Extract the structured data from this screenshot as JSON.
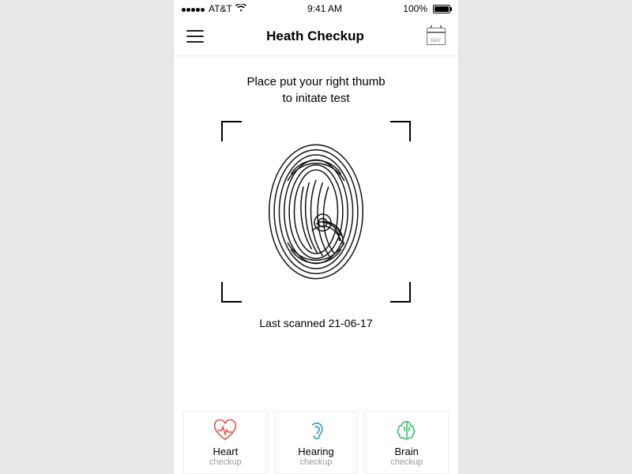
{
  "status": {
    "carrier": "AT&T",
    "time": "9:41 AM",
    "battery": "100%"
  },
  "header": {
    "title": "Heath Checkup",
    "calendar_label": "DAY"
  },
  "main": {
    "instruction": "Place put your right thumb\nto initate test",
    "last_scanned_prefix": "Last scanned ",
    "last_scanned_date": "21-06-17"
  },
  "cards": [
    {
      "label": "Heart",
      "sub": "checkup"
    },
    {
      "label": "Hearing",
      "sub": "checkup"
    },
    {
      "label": "Brain",
      "sub": "checkup"
    }
  ]
}
